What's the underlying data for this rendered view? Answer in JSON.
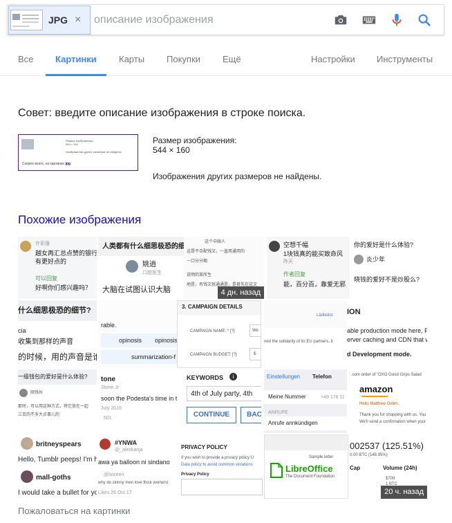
{
  "search": {
    "chip_label": "JPG",
    "chip_remove": "×",
    "placeholder": "описание изображения",
    "value": ""
  },
  "tabs": [
    "Все",
    "Картинки",
    "Карты",
    "Покупки",
    "Ещё",
    "Настройки",
    "Инструменты"
  ],
  "active_tab": "Картинки",
  "tip": "Совет: введите описание изображения в строке поиска.",
  "image_info": {
    "size_label": "Размер изображения:",
    "size_value": "544 × 160",
    "no_other_sizes": "Изображения других размеров не найдены."
  },
  "thumbnail": {
    "line1": "Размер изображения:",
    "line2": "544 × 160",
    "line3": "Изображения других размеров не найдены.",
    "link_text": "Скорее всего, на картинке",
    "link_query": "jpg"
  },
  "similar_heading": "Похожие изображения",
  "tiles": {
    "t1": {
      "name": "许彩强",
      "l1": "越女再汇总点赞的银行理",
      "l2": "有更好点的",
      "green": "可以回复",
      "l3": "好啊你们感兴趣吗？"
    },
    "t2": {
      "title": "人类都有什么细思极恐的细",
      "name": "姚逍",
      "sub": "口腔医生",
      "body": "大脑在试图认识大脑"
    },
    "t3": {
      "l1": "这个中国人",
      "l2": "这是不合配钱文，一直用通用的",
      "l3": "一口分分期",
      "l4": "说明的某所生",
      "l5": "地是，有钱文就通通是，是首先在这文"
    },
    "t4": {
      "name": "空想千幅",
      "l1": "1块钱真的能买致命风",
      "g": "昨天",
      "green": "作者回复",
      "l2": "能，百分百，靠爱无邪"
    },
    "t5": {
      "l1": "你的爱好是什么体验?",
      "l2": "炎少年",
      "l3": "晓钱的爱好不是炒股么?"
    },
    "t6": {
      "l1": "什么细思极恐的细节?",
      "l2": "cia",
      "l3": "收集到那样的声音",
      "l4": "的时候，用的声音是谁的"
    },
    "t7": {
      "l1": "rable.",
      "tag1": "opinosis",
      "tag2": "opinosis",
      "tag3": "summarization-f"
    },
    "t8": {
      "title": "3. CAMPAIGN DETAILS",
      "f1": "CAMPAIGN NAME: * [?]",
      "f1v": "We",
      "f2": "CAMPAIGN BUDGET: [?]",
      "f2v": "$"
    },
    "t9": {
      "l1": "ned the solidarity of its EU partners, it",
      "l2": "Lädtedot"
    },
    "t10": {
      "l1": "ION",
      "l2": "able production mode here, Produ",
      "l3": "erver caching and CDN that we h",
      "l4": "d Development mode."
    },
    "t11": {
      "l1": "一级钱包的爱好是什么体验?",
      "l2": "硕钱长",
      "l3": "那时，可以用这种方式，将它放在一起",
      "l4": "三百的不多大点事儿的"
    },
    "t12": {
      "l1": "tone",
      "l2": "Stone.Jr",
      "l3": "soon the Podesta's time in the I",
      "l4": "July 2016",
      "l5": "501"
    },
    "t13": {
      "title": "KEYWORDS",
      "value": "4th of July party, 4th",
      "btn1": "CONTINUE",
      "btn2": "BAC"
    },
    "t14": {
      "back": "Einstellungen",
      "title": "Telefon",
      "row1": "Meine Nummer",
      "row1v": "+49 176 11",
      "section": "ANRUFE",
      "row2": "Anrufe annkündigen"
    },
    "t15": {
      "l1": ".com order of \"OXO Good Grips Salad",
      "brand": "amazon",
      "l2": "Hello Matthew Oxten,",
      "l3": "Thank you for shopping with us. You",
      "l4": "We'll send a confirmation when your it"
    },
    "t16": {
      "name": "britneyspears",
      "l1": "Hello, Tumblr peeps! I'm her",
      "name2": "mall-goths",
      "l2": "I would take a bullet for you"
    },
    "t17": {
      "tag": "#YNWA",
      "user": "@_alexkanja",
      "l1": "awa ya balloon ni sindano",
      "user2": "@luizeen",
      "l2": "why do skinny men love thick womenz",
      "date": "Likes  26 Oct 17"
    },
    "t18": {
      "title": "PRIVACY POLICY",
      "l1": "If you wish to provide a privacy policy U",
      "l2": "Data policy to avoid common violations",
      "l3": "Privacy Policy"
    },
    "t19": {
      "l1": "Sample letter",
      "name": "LibreOffice",
      "sub": "The Document Foundation"
    },
    "t20": {
      "l1": "002537 (125.51%)",
      "l2": "0.00 BTC (148.95%)",
      "l3": "Cap",
      "l4": "Volume (24h)",
      "l5": "$709",
      "l6": "1 BTC"
    }
  },
  "badges": {
    "b1": "4 дн. назад",
    "b2": "20 ч. назад"
  },
  "report_link": "Пожаловаться на картинки",
  "colors": {
    "accent": "#4285f4",
    "link": "#1a0dab",
    "visited": "#551a8b",
    "amazon_orange": "#ff9900",
    "libre_green": "#18a303"
  },
  "icons": [
    "camera-icon",
    "keyboard-icon",
    "microphone-icon",
    "search-icon",
    "close-icon",
    "info-icon"
  ]
}
